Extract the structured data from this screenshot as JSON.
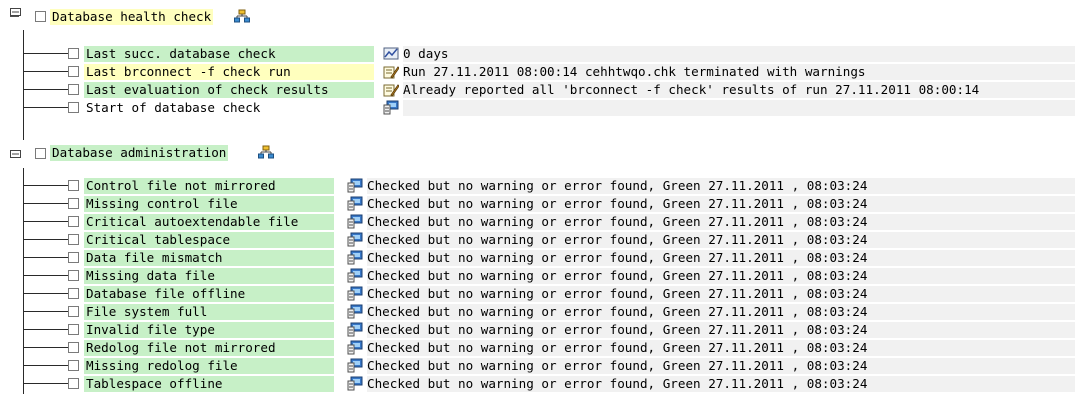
{
  "health_check": {
    "title": "Database health check",
    "rows": [
      {
        "label": "Last succ. database check",
        "icon": "chart-icon",
        "value": "0 days",
        "label_color": "#c7f0c7"
      },
      {
        "label": "Last brconnect -f check run",
        "icon": "pen-doc-icon",
        "value": "Run 27.11.2011 08:00:14 cehhtwqo.chk terminated with warnings",
        "label_color": "#ffffbe"
      },
      {
        "label": "Last evaluation of check results",
        "icon": "pen-doc-icon",
        "value": "Already reported all 'brconnect -f check' results of run 27.11.2011 08:00:14",
        "label_color": "#c7f0c7"
      },
      {
        "label": "Start of database check",
        "icon": "monitor-icon",
        "value": "",
        "label_color": "#ffffff"
      }
    ]
  },
  "administration": {
    "title": "Database administration",
    "rows": [
      {
        "label": "Control file not mirrored",
        "value": "Checked but no warning or error found, Green 27.11.2011 , 08:03:24"
      },
      {
        "label": "Missing control file",
        "value": "Checked but no warning or error found, Green 27.11.2011 , 08:03:24"
      },
      {
        "label": "Critical autoextendable file",
        "value": "Checked but no warning or error found, Green 27.11.2011 , 08:03:24"
      },
      {
        "label": "Critical tablespace",
        "value": "Checked but no warning or error found, Green 27.11.2011 , 08:03:24"
      },
      {
        "label": "Data file mismatch",
        "value": "Checked but no warning or error found, Green 27.11.2011 , 08:03:24"
      },
      {
        "label": "Missing data file",
        "value": "Checked but no warning or error found, Green 27.11.2011 , 08:03:24"
      },
      {
        "label": "Database file offline",
        "value": "Checked but no warning or error found, Green 27.11.2011 , 08:03:24"
      },
      {
        "label": "File system full",
        "value": "Checked but no warning or error found, Green 27.11.2011 , 08:03:24"
      },
      {
        "label": "Invalid file type",
        "value": "Checked but no warning or error found, Green 27.11.2011 , 08:03:24"
      },
      {
        "label": "Redolog file not mirrored",
        "value": "Checked but no warning or error found, Green 27.11.2011 , 08:03:24"
      },
      {
        "label": "Missing redolog file",
        "value": "Checked but no warning or error found, Green 27.11.2011 , 08:03:24"
      },
      {
        "label": "Tablespace offline",
        "value": "Checked but no warning or error found, Green 27.11.2011 , 08:03:24"
      }
    ]
  },
  "colors": {
    "green_label": "#c7f0c7",
    "yellow_label": "#ffffbe"
  }
}
